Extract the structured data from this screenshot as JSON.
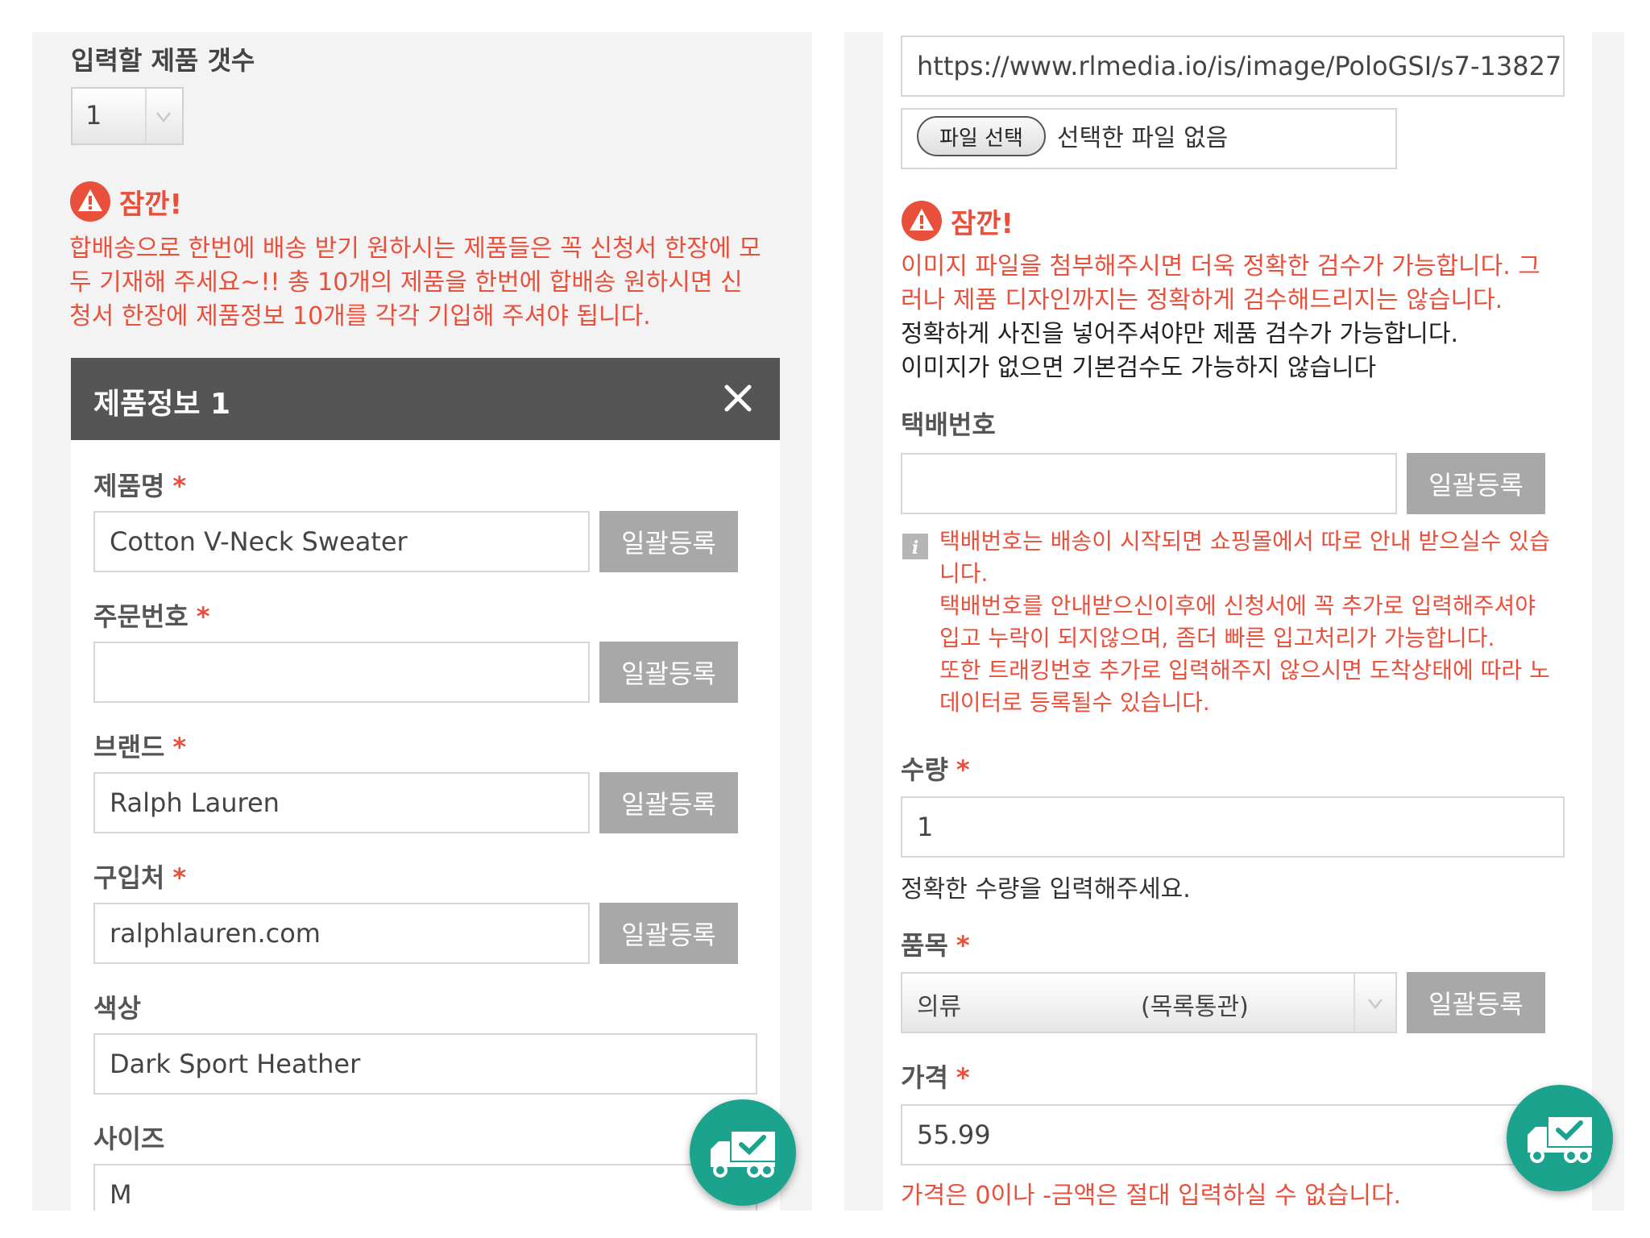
{
  "left": {
    "count_label": "입력할 제품 갯수",
    "count_value": "1",
    "warning_title": "잠깐!",
    "warning_lines": [
      "합배송으로 한번에 배송 받기 원하시는 제품들은 꼭 신청서 한장에 모",
      "두 기재해 주세요~!! 총 10개의 제품을 한번에 합배송 원하시면 신",
      "청서 한장에 제품정보 10개를 각각 기입해 주셔야 됩니다."
    ],
    "card_title": "제품정보 1",
    "bulk_label": "일괄등록",
    "fields": {
      "product_name": {
        "label": "제품명",
        "value": "Cotton V-Neck Sweater"
      },
      "order_number": {
        "label": "주문번호",
        "value": ""
      },
      "brand": {
        "label": "브랜드",
        "value": "Ralph Lauren"
      },
      "store": {
        "label": "구입처",
        "value": "ralphlauren.com"
      },
      "color": {
        "label": "색상",
        "value": "Dark Sport Heather"
      },
      "size": {
        "label": "사이즈",
        "value": "M"
      }
    },
    "required_mark": "*"
  },
  "right": {
    "image_url": "https://www.rlmedia.io/is/image/PoloGSI/s7-13827",
    "file_button": "파일 선택",
    "file_status": "선택한 파일 없음",
    "warning_title": "잠깐!",
    "warning_red_lines": [
      "이미지 파일을 첨부해주시면 더욱 정확한 검수가 가능합니다. 그",
      "러나 제품 디자인까지는 정확하게 검수해드리지는 않습니다."
    ],
    "warning_black_lines": [
      "정확하게 사진을 넣어주셔야만 제품 검수가 가능합니다.",
      "이미지가 없으면 기본검수도 가능하지 않습니다"
    ],
    "tracking_label": "택배번호",
    "tracking_value": "",
    "bulk_label": "일괄등록",
    "tracking_info_lines": [
      "택배번호는 배송이 시작되면 쇼핑몰에서 따로 안내 받으실수 있습",
      "니다.",
      "택배번호를 안내받으신이후에 신청서에 꼭 추가로 입력해주셔야",
      "입고 누락이 되지않으며, 좀더 빠른 입고처리가 가능합니다.",
      "또한 트래킹번호 추가로 입력해주지 않으시면 도착상태에 따라 노",
      "데이터로 등록될수 있습니다."
    ],
    "quantity_label": "수량",
    "quantity_value": "1",
    "quantity_hint": "정확한 수량을 입력해주세요.",
    "category_label": "품목",
    "category_value": "의류",
    "category_note": "(목록통관)",
    "price_label": "가격",
    "price_value": "55.99",
    "price_hint": "가격은 0이나 -금액은 절대 입력하실 수 없습니다.",
    "required_mark": "*"
  },
  "colors": {
    "accent_red": "#e8503c",
    "fab_teal": "#1ba38d",
    "header_gray": "#555555",
    "button_gray": "#a8a8a8"
  },
  "icons": {
    "warning": "warning-triangle-icon",
    "close": "close-icon",
    "info": "info-icon",
    "dropdown": "chevron-down-icon",
    "delivery": "delivery-truck-check-icon"
  }
}
